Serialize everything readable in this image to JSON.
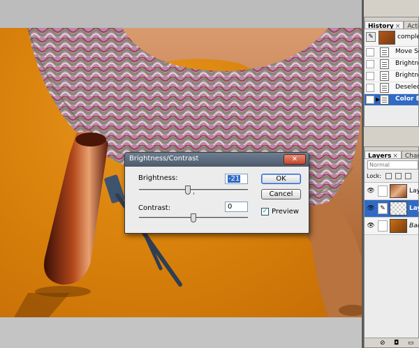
{
  "history_panel": {
    "tabs": [
      {
        "label": "History",
        "active": true
      },
      {
        "label": "Actions",
        "active": false
      }
    ],
    "snapshot_label": "complete",
    "items": [
      {
        "label": "Move Sele",
        "current": false
      },
      {
        "label": "Brightnes",
        "current": false
      },
      {
        "label": "Brightnes",
        "current": false
      },
      {
        "label": "Deselect",
        "current": false
      },
      {
        "label": "Color Ba",
        "current": true
      }
    ]
  },
  "layers_panel": {
    "tabs": [
      {
        "label": "Layers",
        "active": true
      },
      {
        "label": "Channel",
        "active": false
      }
    ],
    "blend_mode": "Normal",
    "lock_label": "Lock:",
    "layers": [
      {
        "label": "Lay",
        "selected": false
      },
      {
        "label": "Lay",
        "selected": true
      },
      {
        "label": "Back",
        "selected": false
      }
    ]
  },
  "dialog": {
    "title": "Brightness/Contrast",
    "brightness_label": "Brightness:",
    "brightness_value": "-21",
    "brightness_fraction": 0.45,
    "contrast_label": "Contrast:",
    "contrast_value": "0",
    "contrast_fraction": 0.5,
    "ok_label": "OK",
    "cancel_label": "Cancel",
    "preview_label": "Preview",
    "preview_checked": true
  },
  "colors": {
    "selection": "#316ac5",
    "canvas_orange": "#d9820c"
  }
}
